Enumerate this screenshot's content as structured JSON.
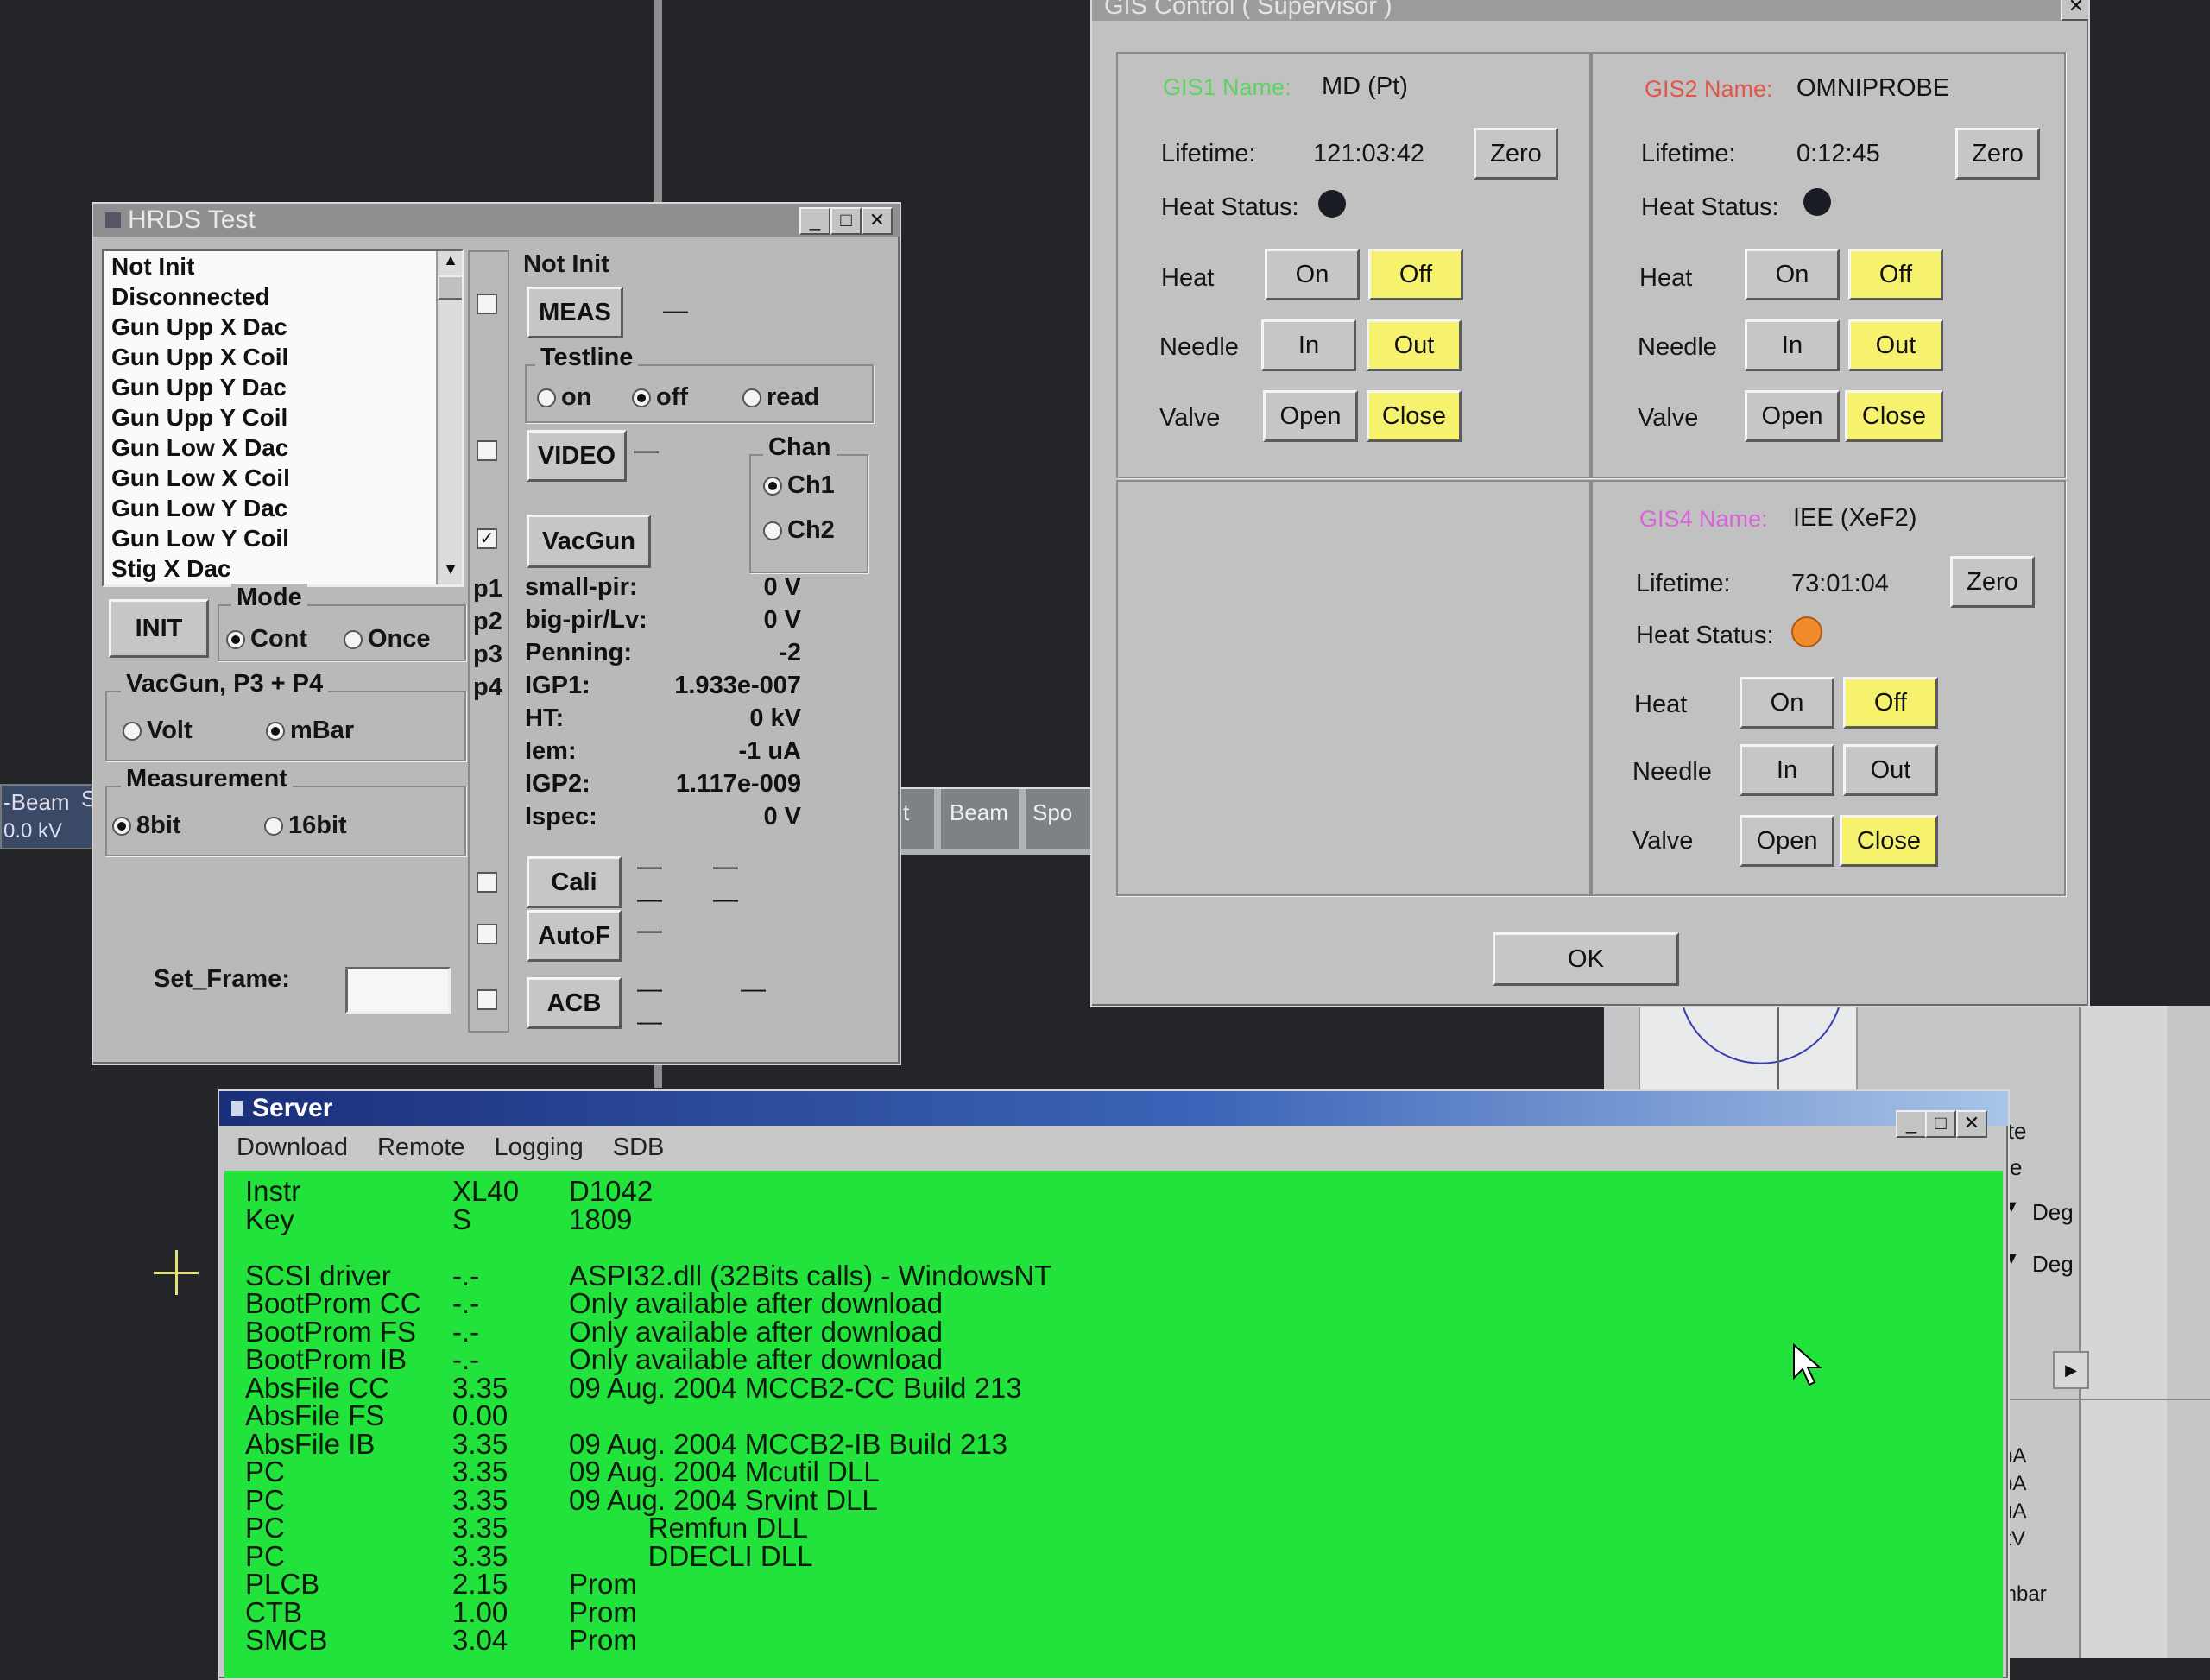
{
  "background_tabs": {
    "beam": "Beam",
    "spot": "Spo",
    "beam_left": "-Beam",
    "kv_left": "0.0 kV",
    "t_left": "t",
    "s_left": "S"
  },
  "right_panel": {
    "te": "ite",
    "e": "e",
    "deg1": "Deg",
    "deg2": "Deg",
    "units": [
      "pA",
      "pA",
      "uA",
      "kV"
    ],
    "mbar": "mbar"
  },
  "hrds": {
    "title": "HRDS Test",
    "list_items": [
      "Not Init",
      "Disconnected",
      "Gun Upp X Dac",
      "Gun Upp X Coil",
      "Gun Upp Y Dac",
      "Gun Upp Y Coil",
      "Gun Low X Dac",
      "Gun Low X Coil",
      "Gun Low Y Dac",
      "Gun Low Y Coil",
      "Stig X Dac"
    ],
    "status": "Not Init",
    "meas_label": "MEAS",
    "dash": "—",
    "testline": {
      "label": "Testline",
      "on": "on",
      "off": "off",
      "read": "read",
      "selected": "off"
    },
    "video_label": "VIDEO",
    "chan": {
      "label": "Chan",
      "ch1": "Ch1",
      "ch2": "Ch2",
      "selected": "Ch1"
    },
    "vacgun_label": "VacGun",
    "mode": {
      "label": "Mode",
      "cont": "Cont",
      "once": "Once",
      "selected": "Cont"
    },
    "init_label": "INIT",
    "vacgun_group": {
      "label": "VacGun, P3 + P4",
      "volt": "Volt",
      "mbar": "mBar",
      "selected": "mBar"
    },
    "measurement": {
      "label": "Measurement",
      "bit8": "8bit",
      "bit16": "16bit",
      "selected": "8bit"
    },
    "pressure_tags": [
      "p1",
      "p2",
      "p3",
      "p4"
    ],
    "readings": [
      {
        "name": "small-pir:",
        "value": "0 V"
      },
      {
        "name": "big-pir/Lv:",
        "value": "0 V"
      },
      {
        "name": "Penning:",
        "value": "-2"
      },
      {
        "name": "IGP1:",
        "value": "1.933e-007"
      },
      {
        "name": "HT:",
        "value": "0 kV"
      },
      {
        "name": "Iem:",
        "value": "-1 uA"
      },
      {
        "name": "IGP2:",
        "value": "1.117e-009"
      },
      {
        "name": "Ispec:",
        "value": "0 V"
      }
    ],
    "cali_label": "Cali",
    "autof_label": "AutoF",
    "acb_label": "ACB",
    "set_frame_label": "Set_Frame:",
    "set_frame_value": ""
  },
  "gis": {
    "title": "GIS Control ( Supervisor )",
    "ok_label": "OK",
    "labels": {
      "lifetime": "Lifetime:",
      "heat_status": "Heat Status:",
      "heat": "Heat",
      "needle": "Needle",
      "valve": "Valve",
      "zero": "Zero",
      "on": "On",
      "off": "Off",
      "in": "In",
      "out": "Out",
      "open": "Open",
      "close": "Close"
    },
    "gis1": {
      "name_label": "GIS1 Name:",
      "name": "MD (Pt)",
      "lifetime": "121:03:42",
      "label_color": "#5fd35f",
      "led_color": "#1b1d24"
    },
    "gis2": {
      "name_label": "GIS2 Name:",
      "name": "OMNIPROBE",
      "lifetime": "0:12:45",
      "label_color": "#e0574a",
      "led_color": "#1b1d24"
    },
    "gis4": {
      "name_label": "GIS4 Name:",
      "name": "IEE (XeF2)",
      "lifetime": "73:01:04",
      "label_color": "#d866d8",
      "led_color": "#f08a2a"
    }
  },
  "server": {
    "title": "Server",
    "menu": [
      "Download",
      "Remote",
      "Logging",
      "SDB"
    ],
    "bg_color": "#22e23c",
    "rows": [
      [
        "Instr",
        "XL40",
        "D1042"
      ],
      [
        "Key",
        "S",
        "1809"
      ],
      [
        "",
        "",
        ""
      ],
      [
        "SCSI driver",
        "-.-",
        "ASPI32.dll (32Bits calls) - WindowsNT"
      ],
      [
        "BootProm CC",
        "-.-",
        "Only available after download"
      ],
      [
        "BootProm FS",
        "-.-",
        "Only available after download"
      ],
      [
        "BootProm IB",
        "-.-",
        "Only available after download"
      ],
      [
        "AbsFile CC",
        "3.35",
        "09 Aug. 2004 MCCB2-CC Build 213"
      ],
      [
        "AbsFile FS",
        "0.00",
        ""
      ],
      [
        "AbsFile IB",
        "3.35",
        "09 Aug. 2004 MCCB2-IB Build 213"
      ],
      [
        "PC",
        "3.35",
        "09 Aug. 2004 Mcutil DLL"
      ],
      [
        "PC",
        "3.35",
        "09 Aug. 2004 Srvint DLL"
      ],
      [
        "PC",
        "3.35",
        "          Remfun DLL"
      ],
      [
        "PC",
        "3.35",
        "          DDECLI DLL"
      ],
      [
        "PLCB",
        "2.15",
        "Prom"
      ],
      [
        "CTB",
        "1.00",
        "Prom"
      ],
      [
        "SMCB",
        "3.04",
        "Prom"
      ]
    ]
  }
}
